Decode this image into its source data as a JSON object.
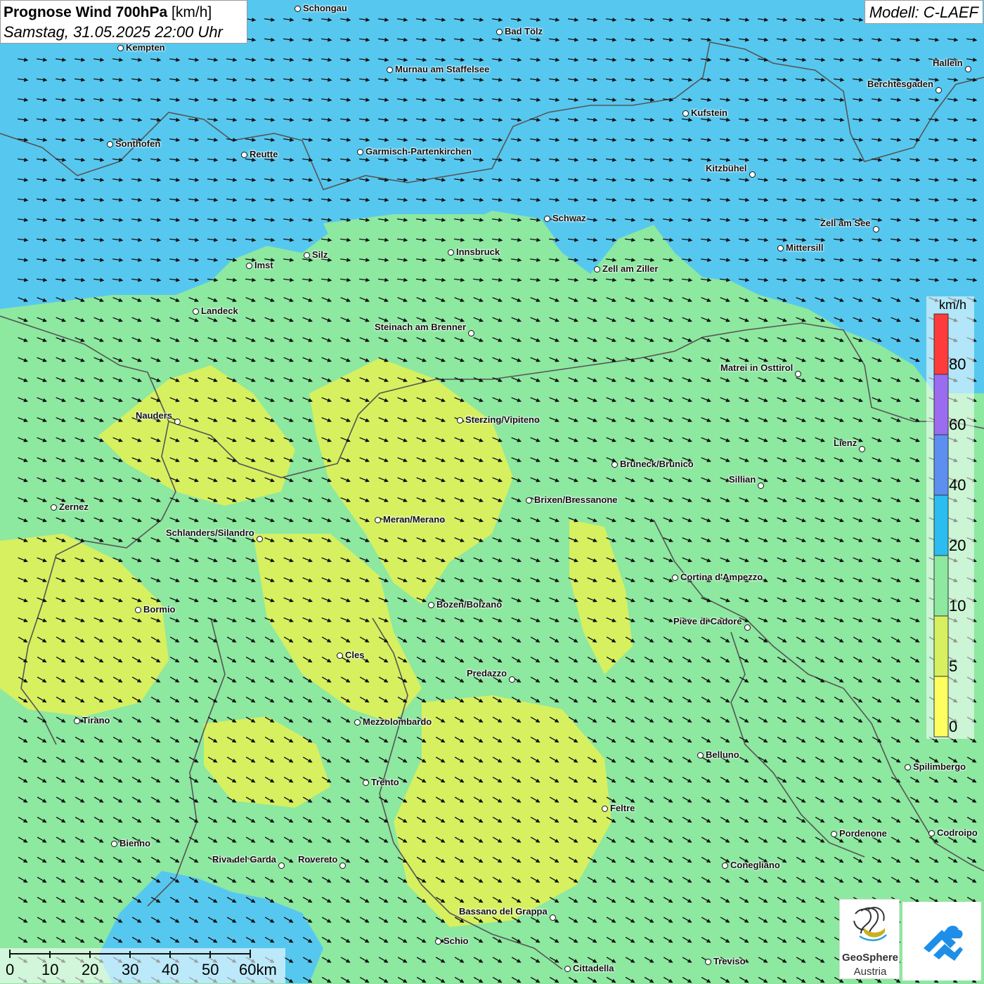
{
  "title": {
    "bold": "Prognose Wind 700hPa",
    "unit": "[km/h]",
    "datetime": "Samstag, 31.05.2025 22:00 Uhr"
  },
  "model": "Modell: C-LAEF",
  "legend": {
    "unit": "km/h",
    "ticks": [
      "80",
      "60",
      "40",
      "20",
      "10",
      "5",
      "0"
    ],
    "colors": [
      "#ff3b3b",
      "#9b6cf0",
      "#5c8ff0",
      "#2bbcf0",
      "#8de8a0",
      "#d7f060",
      "#ffff60"
    ]
  },
  "scale": {
    "labels": [
      "0",
      "10",
      "20",
      "30",
      "40",
      "50",
      "60km"
    ]
  },
  "logos": {
    "geosphere_line1": "GeoSphere",
    "geosphere_line2": "Austria"
  },
  "colors": {
    "fast": "#56c8f0",
    "medium": "#8de8a0",
    "slow": "#d7f060"
  },
  "cities": [
    {
      "name": "Schongau",
      "label_side": "right"
    },
    {
      "name": "Bad Tölz",
      "label_side": "right"
    },
    {
      "name": "Kempten",
      "label_side": "right"
    },
    {
      "name": "Murnau am Staffelsee",
      "label_side": "right"
    },
    {
      "name": "Hallein",
      "label_side": "left"
    },
    {
      "name": "Berchtesgaden",
      "label_side": "left"
    },
    {
      "name": "Kufstein",
      "label_side": "right"
    },
    {
      "name": "Sonthofen",
      "label_side": "right"
    },
    {
      "name": "Reutte",
      "label_side": "right"
    },
    {
      "name": "Garmisch-Partenkirchen",
      "label_side": "right"
    },
    {
      "name": "Kitzbühel",
      "label_side": "left"
    },
    {
      "name": "Schwaz",
      "label_side": "right"
    },
    {
      "name": "Zell am See",
      "label_side": "left"
    },
    {
      "name": "Innsbruck",
      "label_side": "right"
    },
    {
      "name": "Mittersill",
      "label_side": "right"
    },
    {
      "name": "Silz",
      "label_side": "right"
    },
    {
      "name": "Imst",
      "label_side": "right"
    },
    {
      "name": "Zell am Ziller",
      "label_side": "right"
    },
    {
      "name": "Landeck",
      "label_side": "right"
    },
    {
      "name": "Steinach am Brenner",
      "label_side": "left"
    },
    {
      "name": "Matrei in Osttirol",
      "label_side": "left"
    },
    {
      "name": "Nauders",
      "label_side": "left"
    },
    {
      "name": "Sterzing/Vipiteno",
      "label_side": "right"
    },
    {
      "name": "Lienz",
      "label_side": "left"
    },
    {
      "name": "Bruneck/Brunico",
      "label_side": "right"
    },
    {
      "name": "Sillian",
      "label_side": "left"
    },
    {
      "name": "Brixen/Bressanone",
      "label_side": "right"
    },
    {
      "name": "Zernez",
      "label_side": "right"
    },
    {
      "name": "Meran/Merano",
      "label_side": "right"
    },
    {
      "name": "Schlanders/Silandro",
      "label_side": "left"
    },
    {
      "name": "Cortina d'Ampezzo",
      "label_side": "right"
    },
    {
      "name": "Bozen/Bolzano",
      "label_side": "right"
    },
    {
      "name": "Bormio",
      "label_side": "right"
    },
    {
      "name": "Pieve di Cadore",
      "label_side": "left"
    },
    {
      "name": "Cles",
      "label_side": "right"
    },
    {
      "name": "Predazzo",
      "label_side": "left"
    },
    {
      "name": "Tirano",
      "label_side": "right"
    },
    {
      "name": "Mezzolombardo",
      "label_side": "right"
    },
    {
      "name": "Belluno",
      "label_side": "right"
    },
    {
      "name": "Spilimbergo",
      "label_side": "right"
    },
    {
      "name": "Trento",
      "label_side": "right"
    },
    {
      "name": "Feltre",
      "label_side": "right"
    },
    {
      "name": "Pordenone",
      "label_side": "right"
    },
    {
      "name": "Codroipo",
      "label_side": "right"
    },
    {
      "name": "Bienno",
      "label_side": "right"
    },
    {
      "name": "Riva del Garda",
      "label_side": "left"
    },
    {
      "name": "Rovereto",
      "label_side": "left"
    },
    {
      "name": "Conegliano",
      "label_side": "right"
    },
    {
      "name": "Bassano del Grappa",
      "label_side": "left"
    },
    {
      "name": "Schio",
      "label_side": "right"
    },
    {
      "name": "Treviso",
      "label_side": "right"
    },
    {
      "name": "Cittadella",
      "label_side": "right"
    }
  ]
}
